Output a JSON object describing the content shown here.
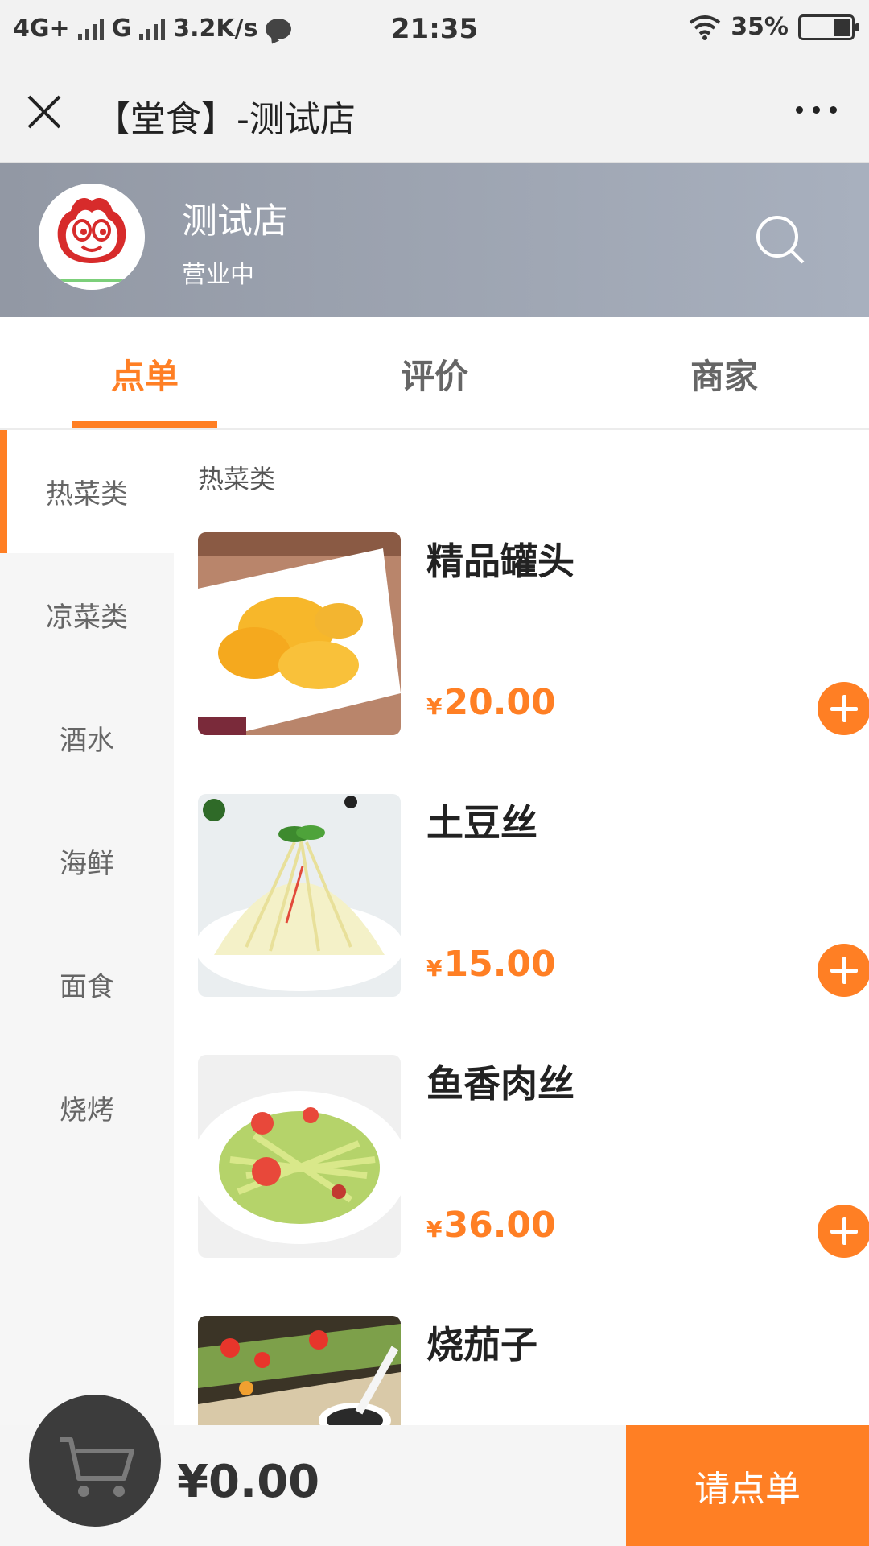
{
  "status_bar": {
    "net1": "4G+",
    "net2": "G",
    "speed": "3.2K/s",
    "time": "21:35",
    "battery": "35%"
  },
  "title_bar": {
    "title": "【堂食】-测试店",
    "close_icon": "close-icon",
    "more_icon": "more-icon"
  },
  "store": {
    "name": "测试店",
    "status": "营业中",
    "search_icon": "search-icon"
  },
  "tabs": [
    {
      "label": "点单",
      "active": true
    },
    {
      "label": "评价",
      "active": false
    },
    {
      "label": "商家",
      "active": false
    }
  ],
  "categories": [
    {
      "label": "热菜类",
      "active": true
    },
    {
      "label": "凉菜类"
    },
    {
      "label": "酒水"
    },
    {
      "label": "海鲜"
    },
    {
      "label": "面食"
    },
    {
      "label": "烧烤"
    }
  ],
  "menu": {
    "section_title": "热菜类",
    "currency": "¥",
    "items": [
      {
        "name": "精品罐头",
        "price": "20.00"
      },
      {
        "name": "土豆丝",
        "price": "15.00"
      },
      {
        "name": "鱼香肉丝",
        "price": "36.00"
      },
      {
        "name": "烧茄子",
        "price": ""
      }
    ]
  },
  "bottom_bar": {
    "total": "¥0.00",
    "order_label": "请点单",
    "cart_icon": "cart-icon"
  },
  "colors": {
    "accent": "#ff7f24",
    "header_bg": "#9aa1ae"
  }
}
